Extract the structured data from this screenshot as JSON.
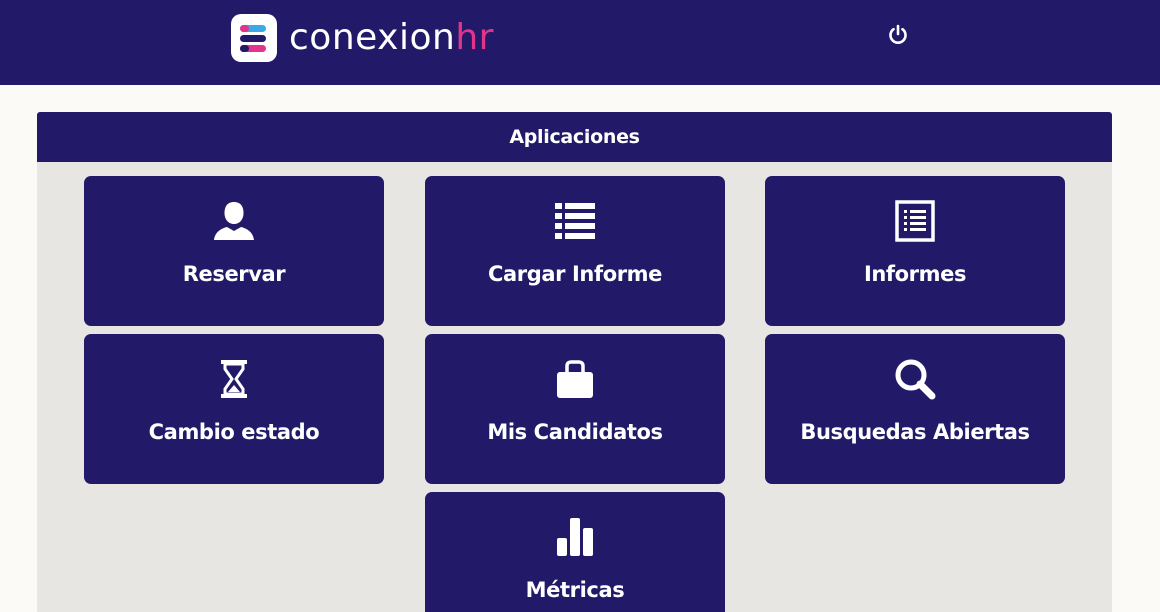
{
  "header": {
    "brand_main": "conexion",
    "brand_accent": "hr",
    "logout_icon": "power-icon"
  },
  "panel": {
    "title": "Aplicaciones"
  },
  "apps": [
    {
      "label": "Reservar",
      "icon": "user-icon"
    },
    {
      "label": "Cargar Informe",
      "icon": "list-icon"
    },
    {
      "label": "Informes",
      "icon": "document-list-icon"
    },
    {
      "label": "Cambio estado",
      "icon": "hourglass-icon"
    },
    {
      "label": "Mis Candidatos",
      "icon": "briefcase-icon"
    },
    {
      "label": "Busquedas Abiertas",
      "icon": "search-icon"
    },
    {
      "label": "Métricas",
      "icon": "bar-chart-icon"
    }
  ],
  "colors": {
    "primary": "#221a68",
    "accent": "#e3348c",
    "background": "#fbfaf6",
    "panel_background": "#e8e6e2"
  }
}
